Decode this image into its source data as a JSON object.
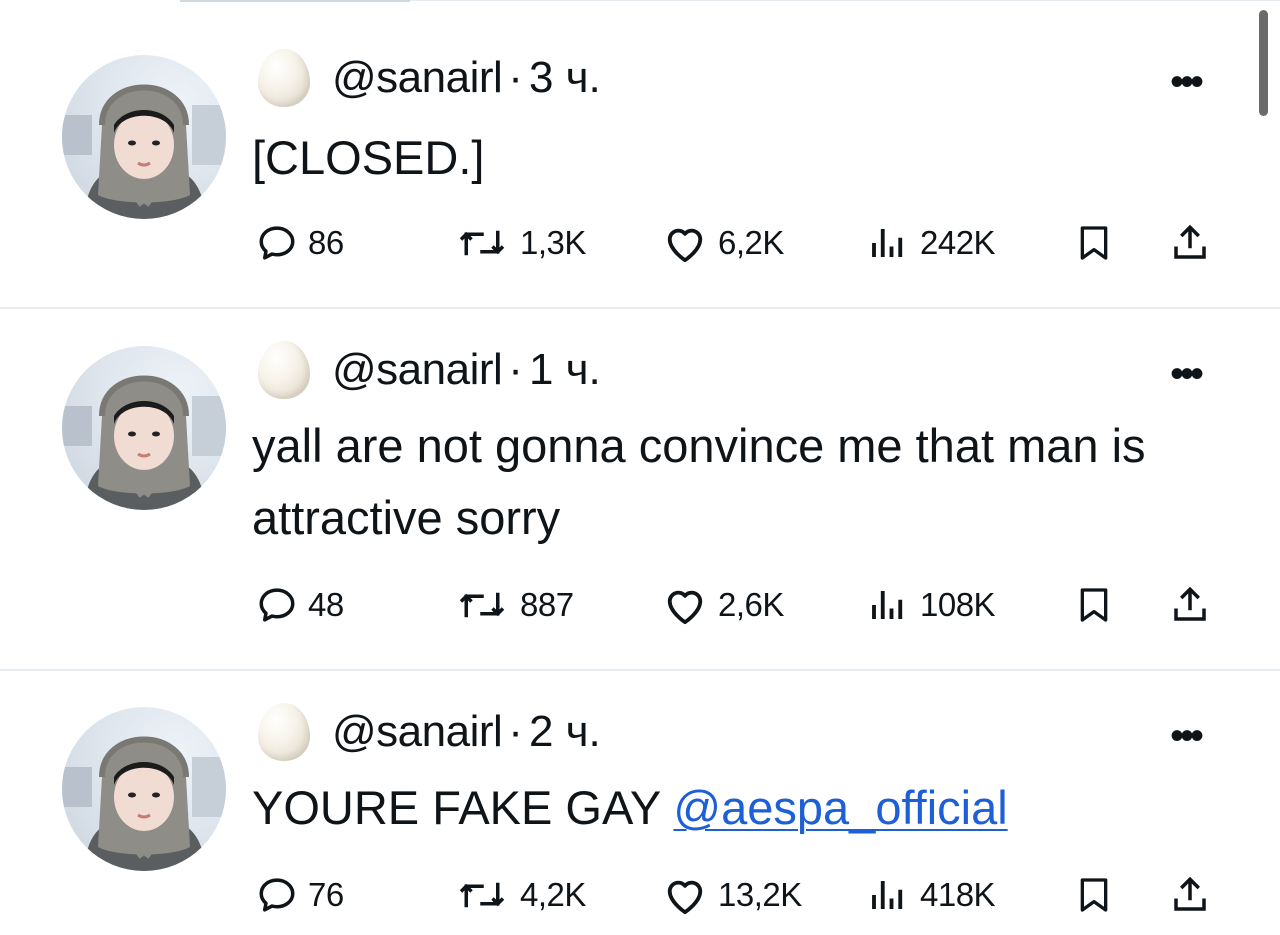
{
  "tweets": [
    {
      "handle": "@sanairl",
      "separator": "·",
      "time": "3 ч.",
      "text": "[CLOSED.]",
      "mention": "",
      "replies": "86",
      "retweets": "1,3K",
      "likes": "6,2K",
      "views": "242K"
    },
    {
      "handle": "@sanairl",
      "separator": "·",
      "time": "1 ч.",
      "text": "yall are not gonna convince me that man is attractive sorry",
      "mention": "",
      "replies": "48",
      "retweets": "887",
      "likes": "2,6K",
      "views": "108K"
    },
    {
      "handle": "@sanairl",
      "separator": "·",
      "time": "2 ч.",
      "text": "YOURE FAKE GAY ",
      "mention": "@aespa_official",
      "replies": "76",
      "retweets": "4,2K",
      "likes": "13,2K",
      "views": "418K"
    }
  ],
  "more_label": "•••",
  "icons": [
    "reply-icon",
    "retweet-icon",
    "like-icon",
    "views-icon",
    "bookmark-icon",
    "share-icon"
  ],
  "colors": {
    "text": "#0f1419",
    "mention": "#1d5fd6",
    "divider": "#e6ecf0"
  }
}
